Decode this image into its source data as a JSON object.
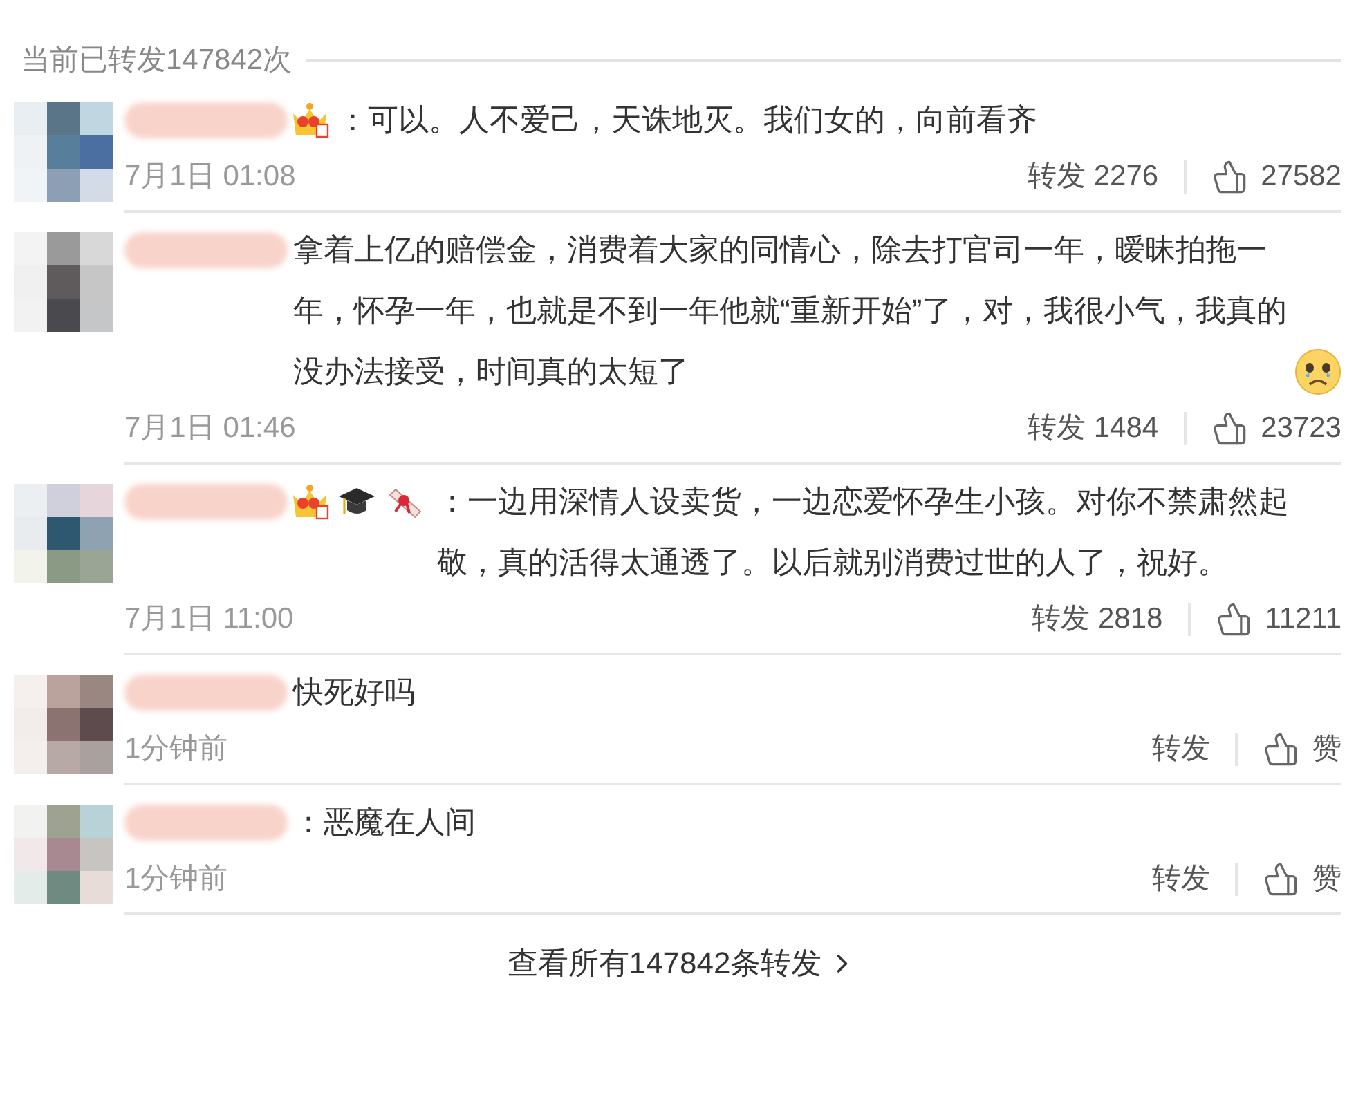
{
  "header": {
    "title": "当前已转发147842次"
  },
  "reposts": [
    {
      "badges": [
        {
          "kind": "crown"
        }
      ],
      "content": "：可以。人不爱己，天诛地灭。我们女的，向前看齐",
      "time": "7月1日 01:08",
      "repost": "转发 2276",
      "like": "27582"
    },
    {
      "content": "拿着上亿的赔偿金，消费着大家的同情心，除去打官司一年，暧昧拍拖一年，怀孕一年，也就是不到一年他就“重新开始”了，对，我很小气，我真的没办法接受，时间真的太短了",
      "emojis": [
        {
          "kind": "crying"
        }
      ],
      "time": "7月1日 01:46",
      "repost": "转发 1484",
      "like": "23723"
    },
    {
      "badges": [
        {
          "kind": "crown"
        },
        {
          "kind": "cap"
        },
        {
          "kind": "scroll"
        }
      ],
      "content": "：一边用深情人设卖货，一边恋爱怀孕生小孩。对你不禁肃然起敬，真的活得太通透了。以后就别消费过世的人了，祝好。",
      "time": "7月1日 11:00",
      "repost": "转发 2818",
      "like": "11211"
    },
    {
      "content": "快死好吗",
      "time": "1分钟前",
      "repost": "转发",
      "like": "赞"
    },
    {
      "content": "：恶魔在人间",
      "time": "1分钟前",
      "repost": "转发",
      "like": "赞"
    }
  ],
  "footer": {
    "link": "查看所有147842条转发"
  }
}
